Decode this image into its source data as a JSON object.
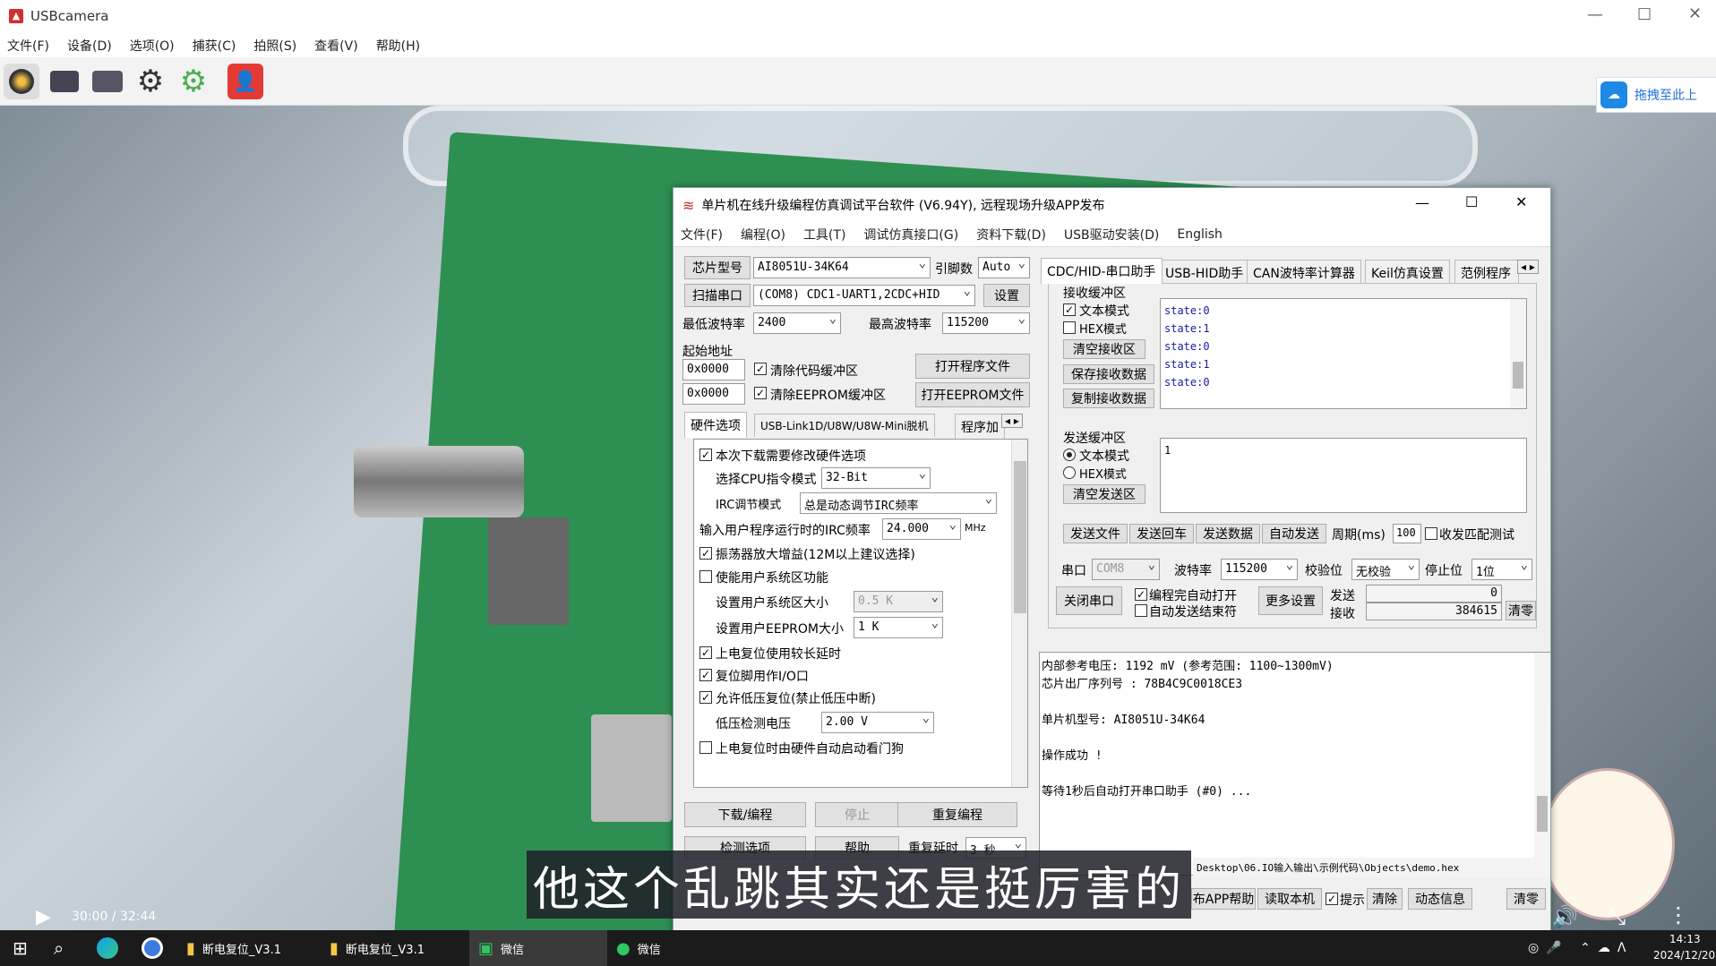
{
  "app": {
    "title": "USBcamera",
    "menus": [
      "文件(F)",
      "设备(D)",
      "选项(O)",
      "捕获(C)",
      "拍照(S)",
      "查看(V)",
      "帮助(H)"
    ],
    "toolbar_icons": [
      "camera-lens-icon",
      "camera-icon",
      "video-camera-icon",
      "settings-icon",
      "settings-alt-icon",
      "user-icon"
    ],
    "side_button": "拖拽至此上"
  },
  "win": {
    "title": "单片机在线升级编程仿真调试平台软件 (V6.94Y), 远程现场升级APP发布",
    "menus": [
      "文件(F)",
      "编程(O)",
      "工具(T)",
      "调试仿真接口(G)",
      "资料下载(D)",
      "USB驱动安装(D)",
      "English"
    ],
    "chip_label": "芯片型号",
    "chip_value": "AI8051U-34K64",
    "pins_label": "引脚数",
    "pins_value": "Auto",
    "scan_btn": "扫描串口",
    "port_value": "(COM8) CDC1-UART1,2CDC+HID",
    "settings_btn": "设置",
    "min_baud_label": "最低波特率",
    "min_baud_value": "2400",
    "max_baud_label": "最高波特率",
    "max_baud_value": "115200",
    "start_addr_label": "起始地址",
    "addr1": "0x0000",
    "clear_code": "清除代码缓冲区",
    "open_prog": "打开程序文件",
    "addr2": "0x0000",
    "clear_eeprom": "清除EEPROM缓冲区",
    "open_eeprom": "打开EEPROM文件",
    "left_tabs": [
      "硬件选项",
      "USB-Link1D/U8W/U8W-Mini脱机",
      "程序加"
    ],
    "hw": {
      "modify": "本次下载需要修改硬件选项",
      "cpu_label": "选择CPU指令模式",
      "cpu_value": "32-Bit",
      "irc_label": "IRC调节模式",
      "irc_value": "总是动态调节IRC频率",
      "freq_label": "输入用户程序运行时的IRC频率",
      "freq_value": "24.000",
      "freq_unit": "MHz",
      "osc": "振荡器放大增益(12M以上建议选择)",
      "sys_area": "使能用户系统区功能",
      "sys_size_label": "设置用户系统区大小",
      "sys_size_value": "0.5 K",
      "eeprom_label": "设置用户EEPROM大小",
      "eeprom_value": "1  K",
      "long_reset": "上电复位使用较长延时",
      "reset_io": "复位脚用作I/O口",
      "lvd_reset": "允许低压复位(禁止低压中断)",
      "lvd_label": "低压检测电压",
      "lvd_value": "2.00 V",
      "wdt": "上电复位时由硬件自动启动看门狗"
    },
    "btn_download": "下载/编程",
    "btn_stop": "停止",
    "btn_reprog": "重复编程",
    "btn_detect": "检测选项",
    "btn_help": "帮助",
    "repeat_delay": "重复延时",
    "repeat_value": "3 秒",
    "right_tabs": [
      "CDC/HID-串口助手",
      "USB-HID助手",
      "CAN波特率计算器",
      "Keil仿真设置",
      "范例程序"
    ],
    "recv": {
      "title": "接收缓冲区",
      "text_mode": "文本模式",
      "hex_mode": "HEX模式",
      "clear": "清空接收区",
      "save": "保存接收数据",
      "copy": "复制接收数据",
      "lines": [
        "state:0",
        "state:1",
        "state:0",
        "state:1",
        "state:0"
      ]
    },
    "send": {
      "title": "发送缓冲区",
      "text_mode": "文本模式",
      "hex_mode": "HEX模式",
      "clear": "清空发送区",
      "content": "1"
    },
    "send_btns": [
      "发送文件",
      "发送回车",
      "发送数据",
      "自动发送"
    ],
    "period_label": "周期(ms)",
    "period_value": "100",
    "match_test": "收发匹配测试",
    "port_label": "串口",
    "port_com": "COM8",
    "baud_label": "波特率",
    "baud_value": "115200",
    "parity_label": "校验位",
    "parity_value": "无校验",
    "stop_label": "停止位",
    "stop_value": "1位",
    "close_port": "关闭串口",
    "auto_open": "编程完自动打开",
    "auto_end": "自动发送结束符",
    "more_settings": "更多设置",
    "send_count_label": "发送",
    "send_count": "0",
    "recv_count_label": "接收",
    "recv_count": "384615",
    "clear_count": "清零",
    "log": [
      "  内部参考电压: 1192 mV (参考范围: 1100~1300mV)",
      "芯片出厂序列号 : 78B4C9C0018CE3",
      "",
      "  单片机型号: AI8051U-34K64",
      "",
      "操作成功 !",
      "",
      "等待1秒后自动打开串口助手 (#0) ..."
    ],
    "path": "Desktop\\06.IO输入输出\\示例代码\\Objects\\demo.hex",
    "bottom_btns": [
      "布APP帮助",
      "读取本机",
      "提示",
      "清除",
      "动态信息",
      "清零"
    ]
  },
  "player": {
    "subtitle": "他这个乱跳其实还是挺厉害的",
    "time": "30:00 / 32:44"
  },
  "taskbar": {
    "items": [
      "断电复位_V3.1",
      "断电复位_V3.1",
      "微信",
      "微信"
    ],
    "clock_time": "14:13",
    "clock_date": "2024/12/20"
  }
}
